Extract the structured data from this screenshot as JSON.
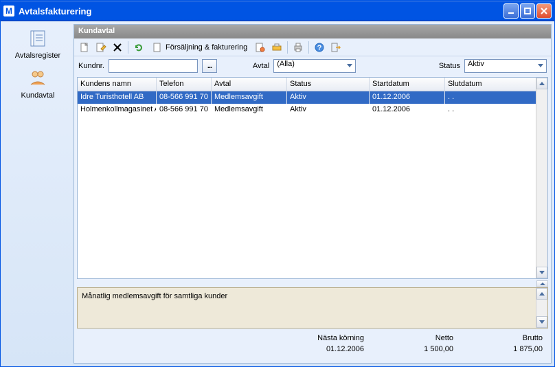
{
  "window": {
    "title": "Avtalsfakturering"
  },
  "sidebar": {
    "items": [
      {
        "label": "Avtalsregister"
      },
      {
        "label": "Kundavtal"
      }
    ]
  },
  "main": {
    "header": "Kundavtal",
    "toolbar": {
      "sales_label": "Försäljning & fakturering"
    },
    "filters": {
      "kundnr_label": "Kundnr.",
      "kundnr_value": "",
      "browse_label": "...",
      "avtal_label": "Avtal",
      "avtal_value": "(Alla)",
      "status_label": "Status",
      "status_value": "Aktiv"
    },
    "grid": {
      "columns": [
        "Kundens namn",
        "Telefon",
        "Avtal",
        "Status",
        "Startdatum",
        "Slutdatum"
      ],
      "rows": [
        {
          "name": "Idre Turisthotell AB",
          "tel": "08-566 991 70",
          "avtal": "Medlemsavgift",
          "status": "Aktiv",
          "start": "01.12.2006",
          "slut": ". ."
        },
        {
          "name": "Holmenkollmagasinet AS",
          "tel": "08-566 991 70",
          "avtal": "Medlemsavgift",
          "status": "Aktiv",
          "start": "01.12.2006",
          "slut": ". ."
        }
      ]
    },
    "description": "Månatlig medlemsavgift för samtliga kunder",
    "footer": {
      "col1_label": "Nästa körning",
      "col1_value": "01.12.2006",
      "col2_label": "Netto",
      "col2_value": "1 500,00",
      "col3_label": "Brutto",
      "col3_value": "1 875,00"
    }
  }
}
